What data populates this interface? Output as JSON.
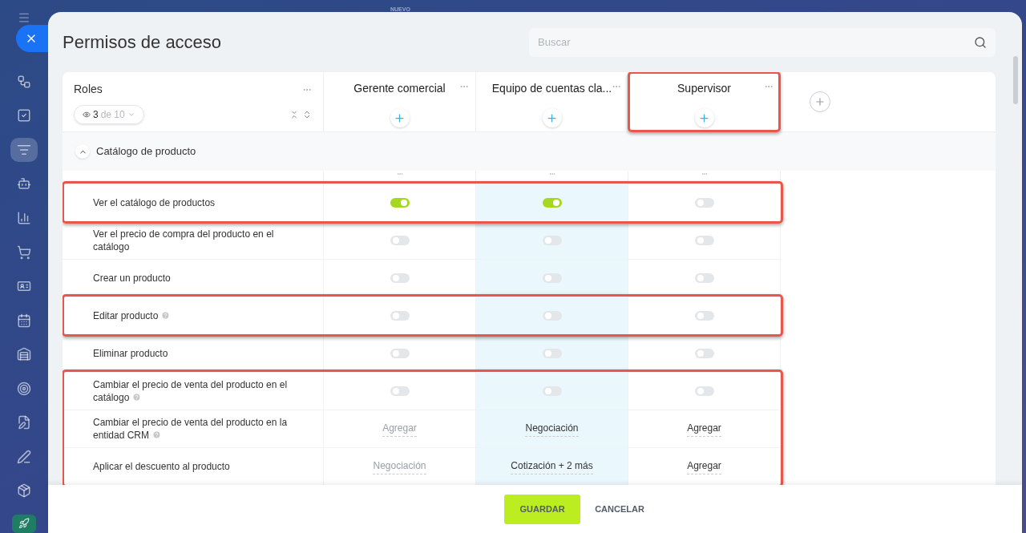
{
  "background_label": "NUEVO",
  "sidebar": {
    "items": [
      {
        "selected": false
      },
      {
        "selected": false
      },
      {
        "selected": true
      },
      {
        "selected": false
      },
      {
        "selected": false
      },
      {
        "selected": false
      },
      {
        "selected": false
      },
      {
        "selected": false
      },
      {
        "selected": false
      },
      {
        "selected": false
      },
      {
        "selected": false
      },
      {
        "selected": false
      },
      {
        "selected": false
      },
      {
        "selected": false
      }
    ]
  },
  "title": "Permisos de acceso",
  "search": {
    "placeholder": "Buscar"
  },
  "roles_header": {
    "label": "Roles",
    "shown": "3",
    "total": "de 10"
  },
  "roles": [
    {
      "name": "Gerente comercial",
      "selected": false,
      "framed": false
    },
    {
      "name": "Equipo de cuentas cla...",
      "selected": true,
      "framed": false
    },
    {
      "name": "Supervisor",
      "selected": false,
      "framed": true
    }
  ],
  "section": {
    "title": "Catálogo de producto",
    "expanded": true
  },
  "rows": [
    {
      "label": "Ver el catálogo de productos",
      "help": false,
      "framed": true,
      "cells": [
        {
          "kind": "toggle",
          "on": true
        },
        {
          "kind": "toggle",
          "on": true
        },
        {
          "kind": "toggle",
          "on": false
        }
      ]
    },
    {
      "label": "Ver el precio de compra del producto en el catálogo",
      "help": false,
      "framed": false,
      "cells": [
        {
          "kind": "toggle",
          "on": false
        },
        {
          "kind": "toggle",
          "on": false
        },
        {
          "kind": "toggle",
          "on": false
        }
      ]
    },
    {
      "label": "Crear un producto",
      "help": false,
      "framed": false,
      "cells": [
        {
          "kind": "toggle",
          "on": false
        },
        {
          "kind": "toggle",
          "on": false
        },
        {
          "kind": "toggle",
          "on": false
        }
      ]
    },
    {
      "label": "Editar producto",
      "help": true,
      "framed": true,
      "cells": [
        {
          "kind": "toggle",
          "on": false
        },
        {
          "kind": "toggle",
          "on": false
        },
        {
          "kind": "toggle",
          "on": false
        }
      ]
    },
    {
      "label": "Eliminar producto",
      "help": false,
      "framed": false,
      "cells": [
        {
          "kind": "toggle",
          "on": false
        },
        {
          "kind": "toggle",
          "on": false
        },
        {
          "kind": "toggle",
          "on": false
        }
      ]
    },
    {
      "label": "Cambiar el precio de venta del producto en el catálogo",
      "help": true,
      "framed": true,
      "cells": [
        {
          "kind": "toggle",
          "on": false
        },
        {
          "kind": "toggle",
          "on": false
        },
        {
          "kind": "toggle",
          "on": false
        }
      ]
    },
    {
      "label": "Cambiar el precio de venta del producto en la entidad CRM",
      "help": true,
      "framed": true,
      "cells": [
        {
          "kind": "link",
          "text": "Agregar",
          "muted": true
        },
        {
          "kind": "link",
          "text": "Negociación",
          "muted": false
        },
        {
          "kind": "link",
          "text": "Agregar",
          "muted": false
        }
      ]
    },
    {
      "label": "Aplicar el descuento al producto",
      "help": false,
      "framed": true,
      "cells": [
        {
          "kind": "link",
          "text": "Negociación",
          "muted": true
        },
        {
          "kind": "link",
          "text": "Cotización + 2 más",
          "muted": false
        },
        {
          "kind": "link",
          "text": "Agregar",
          "muted": false
        }
      ]
    }
  ],
  "buttons": {
    "save": "GUARDAR",
    "cancel": "CANCELAR"
  }
}
